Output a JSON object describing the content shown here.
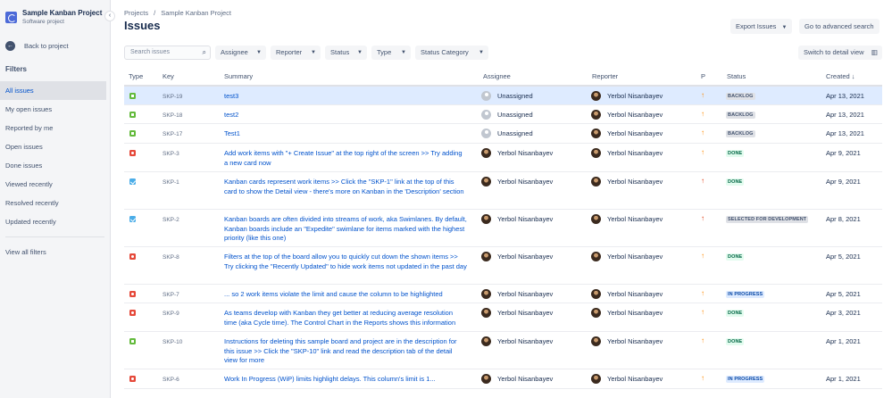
{
  "project": {
    "name": "Sample Kanban Project",
    "type": "Software project"
  },
  "sidebar": {
    "back_label": "Back to project",
    "filters_heading": "Filters",
    "items": [
      {
        "label": "All issues"
      },
      {
        "label": "My open issues"
      },
      {
        "label": "Reported by me"
      },
      {
        "label": "Open issues"
      },
      {
        "label": "Done issues"
      },
      {
        "label": "Viewed recently"
      },
      {
        "label": "Resolved recently"
      },
      {
        "label": "Updated recently"
      }
    ],
    "view_all_label": "View all filters"
  },
  "breadcrumb": {
    "root": "Projects",
    "separator": "/",
    "project": "Sample Kanban Project"
  },
  "page_title": "Issues",
  "toolbar": {
    "export_label": "Export Issues",
    "advanced_label": "Go to advanced search",
    "detail_view_label": "Switch to detail view"
  },
  "filters": {
    "search_placeholder": "Search issues",
    "assignee": "Assignee",
    "reporter": "Reporter",
    "status": "Status",
    "type": "Type",
    "status_category": "Status Category"
  },
  "table": {
    "headers": {
      "type": "Type",
      "key": "Key",
      "summary": "Summary",
      "assignee": "Assignee",
      "reporter": "Reporter",
      "priority": "P",
      "status": "Status",
      "created": "Created"
    },
    "rows": [
      {
        "type": "story",
        "key": "SKP-19",
        "summary": "test3",
        "assignee": "Unassigned",
        "reporter": "Yerbol Nisanbayev",
        "priority": "medium",
        "status": "BACKLOG",
        "created": "Apr 13, 2021"
      },
      {
        "type": "story",
        "key": "SKP-18",
        "summary": "test2",
        "assignee": "Unassigned",
        "reporter": "Yerbol Nisanbayev",
        "priority": "medium",
        "status": "BACKLOG",
        "created": "Apr 13, 2021"
      },
      {
        "type": "story",
        "key": "SKP-17",
        "summary": "Test1",
        "assignee": "Unassigned",
        "reporter": "Yerbol Nisanbayev",
        "priority": "medium",
        "status": "BACKLOG",
        "created": "Apr 13, 2021"
      },
      {
        "type": "bug",
        "key": "SKP-3",
        "summary": "Add work items with \"+ Create Issue\" at the top right of the screen >> Try adding a new card now",
        "assignee": "Yerbol Nisanbayev",
        "reporter": "Yerbol Nisanbayev",
        "priority": "medium",
        "status": "DONE",
        "created": "Apr 9, 2021"
      },
      {
        "type": "task",
        "key": "SKP-1",
        "summary": "Kanban cards represent work items >> Click the \"SKP-1\" link at the top of this card to show the Detail view - there's more on Kanban in the 'Description' section",
        "assignee": "Yerbol Nisanbayev",
        "reporter": "Yerbol Nisanbayev",
        "priority": "high",
        "status": "DONE",
        "created": "Apr 9, 2021"
      },
      {
        "type": "task",
        "key": "SKP-2",
        "summary": "Kanban boards are often divided into streams of work, aka Swimlanes. By default, Kanban boards include an \"Expedite\" swimlane for items marked with the highest priority (like this one)",
        "assignee": "Yerbol Nisanbayev",
        "reporter": "Yerbol Nisanbayev",
        "priority": "high",
        "status": "SELECTED FOR DEVELOPMENT",
        "created": "Apr 8, 2021"
      },
      {
        "type": "bug",
        "key": "SKP-8",
        "summary": "Filters at the top of the board allow you to quickly cut down the shown items >> Try clicking the \"Recently Updated\" to hide work items not updated in the past day",
        "assignee": "Yerbol Nisanbayev",
        "reporter": "Yerbol Nisanbayev",
        "priority": "medium",
        "status": "DONE",
        "created": "Apr 5, 2021"
      },
      {
        "type": "bug",
        "key": "SKP-7",
        "summary": "... so 2 work items violate the limit and cause the column to be highlighted",
        "assignee": "Yerbol Nisanbayev",
        "reporter": "Yerbol Nisanbayev",
        "priority": "medium",
        "status": "IN PROGRESS",
        "created": "Apr 5, 2021"
      },
      {
        "type": "bug",
        "key": "SKP-9",
        "summary": "As teams develop with Kanban they get better at reducing average resolution time (aka Cycle time). The Control Chart in the Reports shows this information",
        "assignee": "Yerbol Nisanbayev",
        "reporter": "Yerbol Nisanbayev",
        "priority": "medium",
        "status": "DONE",
        "created": "Apr 3, 2021"
      },
      {
        "type": "story",
        "key": "SKP-10",
        "summary": "Instructions for deleting this sample board and project are in the description for this issue >> Click the \"SKP-10\" link and read the description tab of the detail view for more",
        "assignee": "Yerbol Nisanbayev",
        "reporter": "Yerbol Nisanbayev",
        "priority": "medium",
        "status": "DONE",
        "created": "Apr 1, 2021"
      },
      {
        "type": "bug",
        "key": "SKP-6",
        "summary": "Work In Progress (WiP) limits highlight delays. This column's limit is 1...",
        "assignee": "Yerbol Nisanbayev",
        "reporter": "Yerbol Nisanbayev",
        "priority": "medium",
        "status": "IN PROGRESS",
        "created": "Apr 1, 2021"
      }
    ]
  },
  "colors": {
    "priority_medium": "#ff8b00",
    "priority_high": "#de350b",
    "status_backlog_bg": "#dfe1e6",
    "status_backlog_fg": "#42526e",
    "status_done_bg": "#e3fcef",
    "status_done_fg": "#006644",
    "status_progress_bg": "#deebff",
    "status_progress_fg": "#0747a6",
    "status_selected_bg": "#dfe1e6",
    "status_selected_fg": "#42526e"
  }
}
